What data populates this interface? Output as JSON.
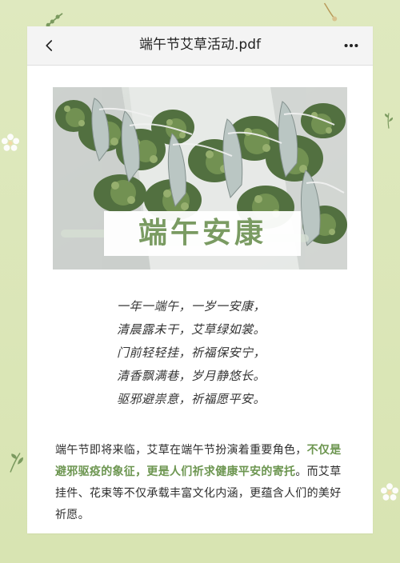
{
  "header": {
    "title": "端午节艾草活动.pdf"
  },
  "hero": {
    "overlay_text": "端午安康"
  },
  "poem": {
    "lines": [
      "一年一端午，一岁一安康，",
      "清晨露未干，艾草绿如裳。",
      "门前轻轻挂，祈福保安宁，",
      "清香飘满巷，岁月静悠长。",
      "驱邪避祟意，祈福愿平安。"
    ]
  },
  "paragraph": {
    "part1": "端午节即将来临，艾草在端午节扮演着重要角色，",
    "highlight": "不仅是避邪驱疫的象征，更是人们祈求健康平安的寄托",
    "part2": "。而艾草挂件、花束等不仅承载丰富文化内涵，更蕴含人们的美好祈愿。"
  },
  "icons": {
    "back": "back-arrow-icon",
    "more": "more-dots-icon",
    "decor": "flower-decoration-icon"
  },
  "colors": {
    "background": "#dbe6b7",
    "card": "#ffffff",
    "header": "#f4f4f4",
    "accent": "#6d9651"
  }
}
